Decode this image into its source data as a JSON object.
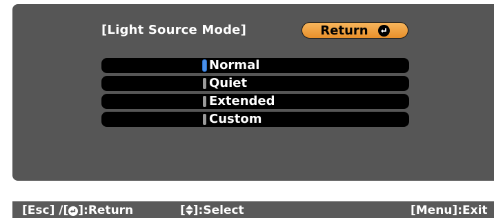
{
  "menu": {
    "title": "[Light Source Mode]",
    "return_label": "Return"
  },
  "options": [
    {
      "label": "Normal",
      "selected": true
    },
    {
      "label": "Quiet",
      "selected": false
    },
    {
      "label": "Extended",
      "selected": false
    },
    {
      "label": "Custom",
      "selected": false
    }
  ],
  "statusbar": {
    "esc_prefix": "[Esc] /[",
    "esc_suffix": "]:Return",
    "select_prefix": "[",
    "select_suffix": "]:Select",
    "exit": "[Menu]:Exit"
  },
  "icons": {
    "return": "enter-icon",
    "select": "up-down-arrow-icon"
  },
  "colors": {
    "panel_bg": "#565656",
    "return_button": "#f0a040",
    "selected_marker": "#4a8fe8"
  }
}
